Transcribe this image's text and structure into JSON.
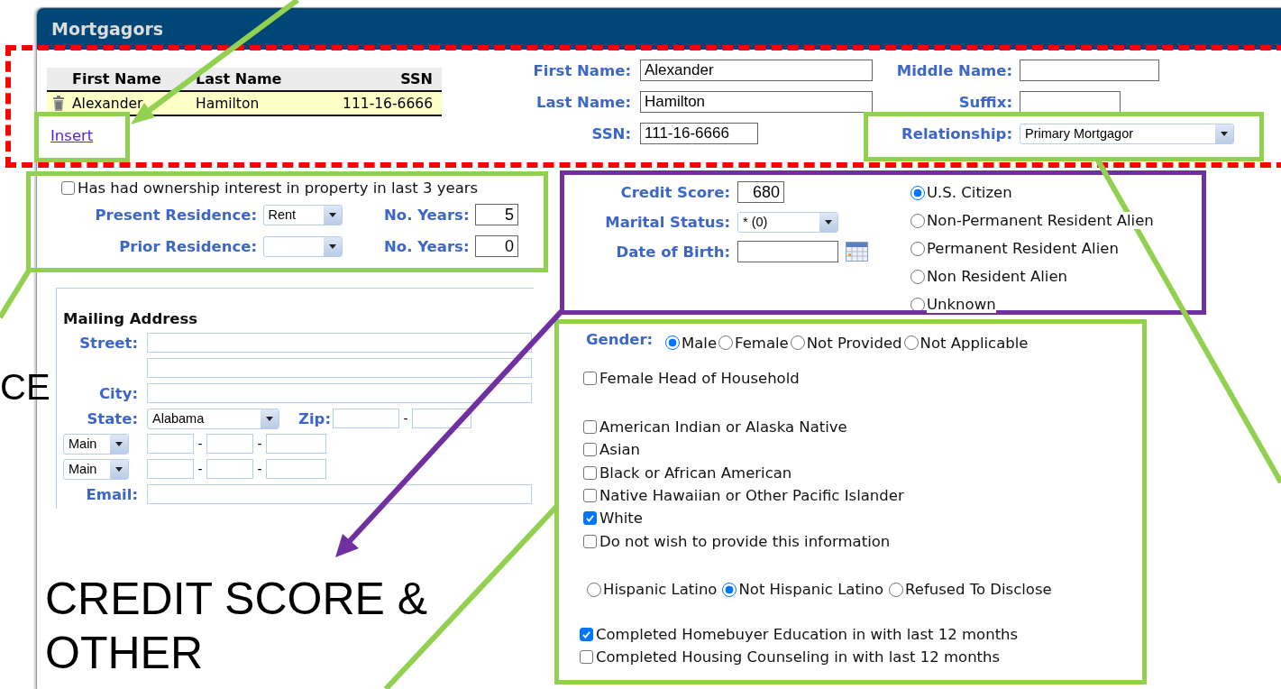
{
  "panel": {
    "title": "Mortgagors"
  },
  "mortgagor_table": {
    "columns": [
      "First Name",
      "Last Name",
      "SSN"
    ],
    "rows": [
      {
        "cells": [
          "Alexander",
          "Hamilton",
          "111-16-6666"
        ],
        "selected": true
      }
    ]
  },
  "insert_link": "Insert",
  "name_fields": [
    {
      "label": "First Name:",
      "value": "Alexander",
      "kind": "text"
    },
    {
      "label": "Middle Name:",
      "kind": "text"
    },
    {
      "label": "Last Name:",
      "value": "Hamilton",
      "kind": "text"
    },
    {
      "label": "Suffix:",
      "kind": "text"
    },
    {
      "label": "SSN:",
      "value": "111-16-6666",
      "kind": "text"
    },
    {
      "label": "Relationship:",
      "value": "Primary Mortgagor",
      "kind": "select"
    }
  ],
  "residence": {
    "ownership": {
      "label": "Has had ownership interest in property in last 3 years",
      "checked": false
    },
    "rows": [
      {
        "label": "Present Residence:",
        "value": "Rent",
        "years_label": "No. Years:",
        "years": "5"
      },
      {
        "label": "Prior Residence:",
        "years_label": "No. Years:",
        "years": "0"
      }
    ]
  },
  "credit": {
    "fields": [
      {
        "kind": "input",
        "label": "Credit Score:",
        "value": "680"
      },
      {
        "kind": "select",
        "label": "Marital Status:",
        "value": "* (0)"
      },
      {
        "kind": "date",
        "label": "Date of Birth:"
      }
    ],
    "citizenship": [
      {
        "label": "U.S. Citizen",
        "selected": true
      },
      {
        "label": "Non-Permanent Resident Alien",
        "selected": false
      },
      {
        "label": "Permanent Resident Alien",
        "selected": false
      },
      {
        "label": "Non Resident Alien",
        "selected": false
      },
      {
        "label": "Unknown",
        "selected": false
      }
    ]
  },
  "mailing_address": {
    "heading": "Mailing Address",
    "rows": [
      {
        "kind": "text",
        "label": "Street:"
      },
      {
        "kind": "text"
      },
      {
        "kind": "text",
        "label": "City:"
      },
      {
        "kind": "state",
        "label": "State:",
        "value": "Alabama",
        "zip_label": "Zip:",
        "separator": "-"
      },
      {
        "kind": "phone",
        "value": "Main",
        "separator": "-"
      },
      {
        "kind": "phone",
        "value": "Main",
        "separator": "-"
      },
      {
        "kind": "text",
        "label": "Email:"
      }
    ]
  },
  "demographics": {
    "gender_label": "Gender:",
    "genders": [
      {
        "label": "Male",
        "selected": true
      },
      {
        "label": "Female",
        "selected": false
      },
      {
        "label": "Not Provided",
        "selected": false
      },
      {
        "label": "Not Applicable",
        "selected": false
      }
    ],
    "female_head": {
      "label": "Female Head of Household",
      "checked": false
    },
    "races": [
      {
        "label": "American Indian or Alaska Native",
        "checked": false
      },
      {
        "label": "Asian",
        "checked": false
      },
      {
        "label": "Black or African American",
        "checked": false
      },
      {
        "label": "Native Hawaiian or Other Pacific Islander",
        "checked": false
      },
      {
        "label": "White",
        "checked": true
      },
      {
        "label": "Do not wish to provide this information",
        "checked": false
      }
    ],
    "ethnicity": [
      {
        "label": "Hispanic Latino",
        "selected": false
      },
      {
        "label": "Not Hispanic Latino",
        "selected": true
      },
      {
        "label": "Refused To Disclose",
        "selected": false
      }
    ],
    "education": [
      {
        "label": "Completed Homebuyer Education in with last 12 months",
        "checked": true
      },
      {
        "label": "Completed Housing Counseling in with last 12 months",
        "checked": false
      }
    ]
  },
  "annotations": {
    "labels": [
      {
        "kind": "edge",
        "text": "CE"
      },
      {
        "kind": "caption",
        "text": "CREDIT SCORE & OTHER"
      }
    ]
  }
}
